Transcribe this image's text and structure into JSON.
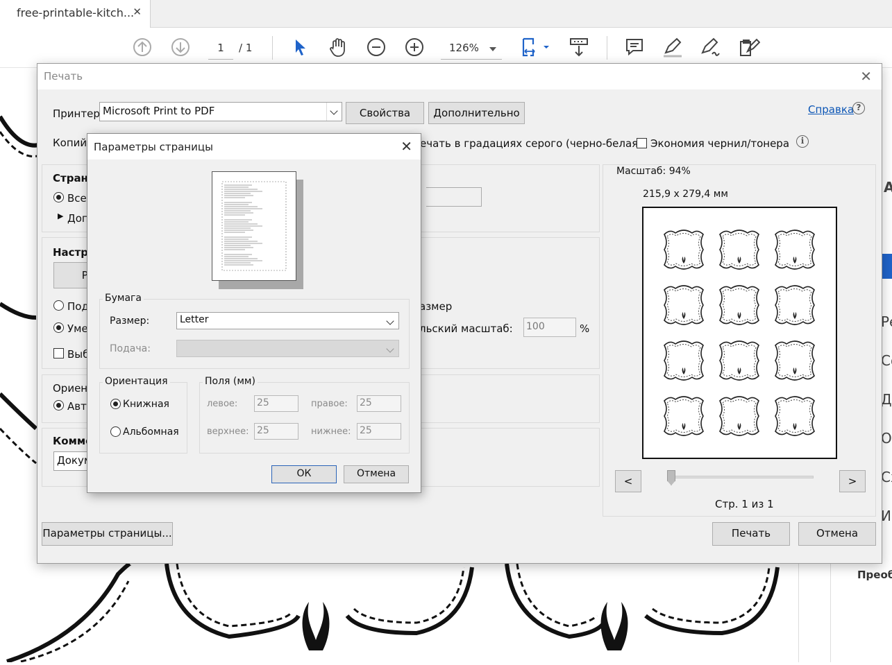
{
  "tab": {
    "title": "free-printable-kitch...",
    "close": "✕"
  },
  "toolbar": {
    "page_current": "1",
    "page_total": "/ 1",
    "zoom": "126%"
  },
  "right_panel": {
    "items": [
      "А",
      "Ре",
      "Со",
      "Де",
      "Ос",
      "Сх",
      "Ис"
    ],
    "bottom": "Преоб"
  },
  "print_dialog": {
    "title": "Печать",
    "printer_label": "Принтер:",
    "printer_value": "Microsoft Print to PDF",
    "properties_btn": "Свойства",
    "advanced_btn": "Дополнительно",
    "help_link": "Справка",
    "copies_label": "Копий:",
    "grayscale_label": "ечать в градациях серого (черно-белая)",
    "save_ink_label": "Экономия чернил/тонера",
    "pages_header": "Страни",
    "pages_all": "Все",
    "pages_more": "Допо",
    "settings_header": "Настро",
    "settings_btn_partial": "Ра",
    "opt_fit": "Подо",
    "opt_shrink": "Умен",
    "opt_choose": "Выб",
    "size_partial": "азмер",
    "scale_label_partial": "льский масштаб:",
    "scale_value": "100",
    "scale_unit": "%",
    "orientation_header": "Ориент",
    "orientation_auto": "Авто",
    "comments_header": "Комме",
    "comments_value": "Докум",
    "scale_info": "Масштаб:  94%",
    "paper_dims": "215,9 x 279,4 мм",
    "prev_btn": "<",
    "next_btn": ">",
    "page_info": "Стр. 1 из 1",
    "page_setup_btn": "Параметры страницы...",
    "print_btn": "Печать",
    "cancel_btn": "Отмена"
  },
  "page_setup": {
    "title": "Параметры страницы",
    "paper_group": "Бумага",
    "size_label": "Размер:",
    "size_value": "Letter",
    "source_label": "Подача:",
    "orientation_group": "Ориентация",
    "portrait": "Книжная",
    "landscape": "Альбомная",
    "margins_group": "Поля (мм)",
    "left_label": "левое:",
    "left_value": "25",
    "right_label": "правое:",
    "right_value": "25",
    "top_label": "верхнее:",
    "top_value": "25",
    "bottom_label": "нижнее:",
    "bottom_value": "25",
    "ok": "ОК",
    "cancel": "Отмена"
  }
}
